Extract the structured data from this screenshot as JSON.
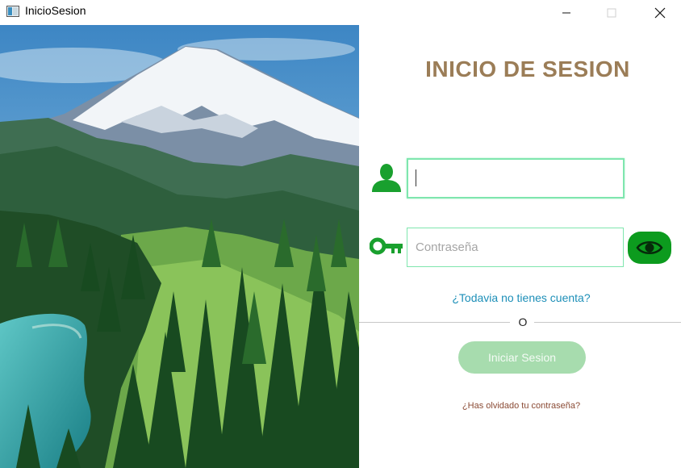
{
  "window": {
    "title": "InicioSesion",
    "icons": {
      "app": "app-window-icon",
      "minimize": "minimize-icon",
      "maximize": "maximize-icon",
      "close": "close-icon"
    }
  },
  "photo": {
    "subject": "mountain-landscape-image"
  },
  "form": {
    "heading": "INICIO DE SESION",
    "username": {
      "value": "",
      "placeholder": "",
      "icon": "user-icon"
    },
    "password": {
      "value": "",
      "placeholder": "Contraseña",
      "icon": "key-icon",
      "toggle_icon": "eye-icon"
    },
    "signup_link": "¿Todavia no tienes cuenta?",
    "divider_text": "O",
    "login_button": "Iniciar Sesion",
    "forgot_link": "¿Has olvidado tu contraseña?"
  },
  "colors": {
    "heading": "#9b7d57",
    "accent_green": "#0c9b1e",
    "field_border": "#7fe6ae",
    "button_bg": "#a7dcae",
    "link": "#1d8fb8",
    "forgot_link": "#8a4a34"
  }
}
